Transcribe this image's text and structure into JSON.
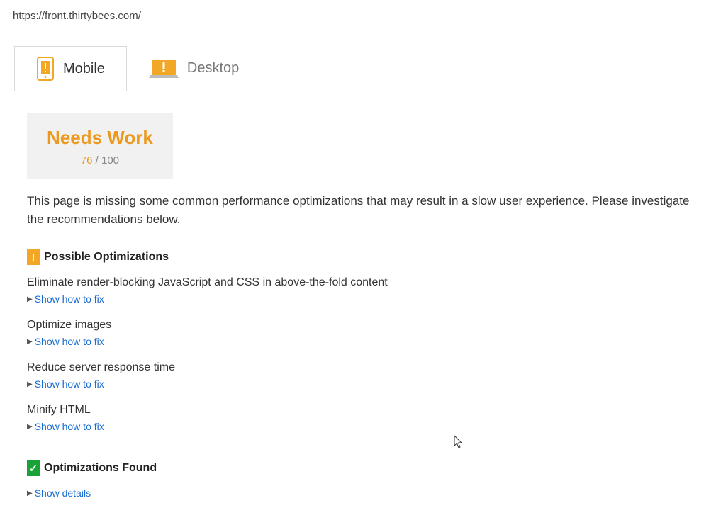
{
  "url": "https://front.thirtybees.com/",
  "tabs": {
    "mobile_label": "Mobile",
    "desktop_label": "Desktop"
  },
  "score": {
    "status_label": "Needs Work",
    "value": "76",
    "divider": " / ",
    "max": "100"
  },
  "summary_text": "This page is missing some common performance optimizations that may result in a slow user experience. Please investigate the recommendations below.",
  "possible_optimizations": {
    "badge": "!",
    "header": "Possible Optimizations",
    "items": [
      {
        "title": "Eliminate render-blocking JavaScript and CSS in above-the-fold content",
        "action": "Show how to fix"
      },
      {
        "title": "Optimize images",
        "action": "Show how to fix"
      },
      {
        "title": "Reduce server response time",
        "action": "Show how to fix"
      },
      {
        "title": "Minify HTML",
        "action": "Show how to fix"
      }
    ]
  },
  "optimizations_found": {
    "badge": "✓",
    "header": "Optimizations Found",
    "action": "Show details"
  },
  "colors": {
    "accent_warn": "#ec9a1f",
    "badge_warn": "#f2a726",
    "badge_ok": "#18a238",
    "link": "#1a6dd0"
  }
}
